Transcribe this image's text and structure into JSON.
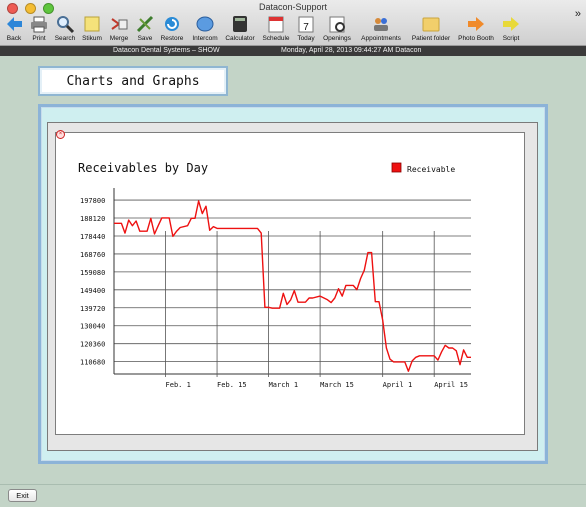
{
  "window": {
    "title": "Datacon-Support"
  },
  "toolbar": [
    {
      "label": "Back",
      "icon": "back-arrow-icon",
      "x": 0
    },
    {
      "label": "Print",
      "icon": "printer-icon",
      "x": 1
    },
    {
      "label": "Search",
      "icon": "search-icon",
      "x": 2
    },
    {
      "label": "Stikum",
      "icon": "sticky-note-icon",
      "x": 3
    },
    {
      "label": "Merge",
      "icon": "merge-icon",
      "x": 4
    },
    {
      "label": "Save",
      "icon": "save-icon",
      "x": 5
    },
    {
      "label": "Restore",
      "icon": "restore-icon",
      "x": 6
    },
    {
      "label": "Intercom",
      "icon": "intercom-icon",
      "x": 7
    },
    {
      "label": "Calculator",
      "icon": "calculator-icon",
      "x": 8
    },
    {
      "label": "Schedule",
      "icon": "schedule-icon",
      "x": 9
    },
    {
      "label": "Today",
      "icon": "calendar-today-icon",
      "x": 10
    },
    {
      "label": "Openings",
      "icon": "openings-icon",
      "x": 11
    },
    {
      "label": "Appointments",
      "icon": "appointments-icon",
      "x": 12
    },
    {
      "label": "Patient folder",
      "icon": "folder-icon",
      "x": 13
    },
    {
      "label": "Photo Booth",
      "icon": "photo-booth-icon",
      "x": 14
    },
    {
      "label": "Script",
      "icon": "script-icon",
      "x": 15
    }
  ],
  "infobar": {
    "left": "Datacon Dental Systems – SHOW",
    "right": "Monday, April 28, 2013  09:44:27 AM  Datacon"
  },
  "page_title": "Charts and Graphs",
  "exit_label": "Exit",
  "colors": {
    "series": "#ee1111",
    "panel_border": "#8cb3d8"
  },
  "chart_data": {
    "type": "line",
    "title": "Receivables by Day",
    "legend": [
      "Receivable"
    ],
    "legend_position": "top-right",
    "ylim": [
      104000,
      200000
    ],
    "yticks": [
      110680,
      120360,
      130040,
      139720,
      149400,
      159080,
      168760,
      178440,
      188120,
      197800
    ],
    "xticks": [
      "Feb. 1",
      "Feb. 15",
      "March 1",
      "March 15",
      "April 1",
      "April 15"
    ],
    "xtick_dates": [
      "2013-02-01",
      "2013-02-15",
      "2013-03-01",
      "2013-03-15",
      "2013-04-01",
      "2013-04-15"
    ],
    "grid": "horizontal",
    "series": [
      {
        "name": "Receivable",
        "points": [
          [
            "2013-01-18",
            185300
          ],
          [
            "2013-01-20",
            185300
          ],
          [
            "2013-01-21",
            180000
          ],
          [
            "2013-01-22",
            187000
          ],
          [
            "2013-01-23",
            184000
          ],
          [
            "2013-01-24",
            186500
          ],
          [
            "2013-01-25",
            181000
          ],
          [
            "2013-01-27",
            181000
          ],
          [
            "2013-01-28",
            188000
          ],
          [
            "2013-01-29",
            179500
          ],
          [
            "2013-01-30",
            184000
          ],
          [
            "2013-01-31",
            188200
          ],
          [
            "2013-02-02",
            188200
          ],
          [
            "2013-02-03",
            178200
          ],
          [
            "2013-02-04",
            181000
          ],
          [
            "2013-02-05",
            183000
          ],
          [
            "2013-02-07",
            184000
          ],
          [
            "2013-02-08",
            188000
          ],
          [
            "2013-02-09",
            188000
          ],
          [
            "2013-02-10",
            197300
          ],
          [
            "2013-02-11",
            190500
          ],
          [
            "2013-02-12",
            194500
          ],
          [
            "2013-02-13",
            181500
          ],
          [
            "2013-02-14",
            183500
          ],
          [
            "2013-02-15",
            182500
          ],
          [
            "2013-02-20",
            182500
          ],
          [
            "2013-02-25",
            182500
          ],
          [
            "2013-02-26",
            182500
          ],
          [
            "2013-02-27",
            180000
          ],
          [
            "2013-02-28",
            140000
          ],
          [
            "2013-03-01",
            140000
          ],
          [
            "2013-03-02",
            139500
          ],
          [
            "2013-03-03",
            139500
          ],
          [
            "2013-03-04",
            139500
          ],
          [
            "2013-03-05",
            147500
          ],
          [
            "2013-03-06",
            141500
          ],
          [
            "2013-03-07",
            144000
          ],
          [
            "2013-03-08",
            149000
          ],
          [
            "2013-03-09",
            142700
          ],
          [
            "2013-03-10",
            142700
          ],
          [
            "2013-03-11",
            142700
          ],
          [
            "2013-03-12",
            145000
          ],
          [
            "2013-03-13",
            145000
          ],
          [
            "2013-03-15",
            146000
          ],
          [
            "2013-03-17",
            144000
          ],
          [
            "2013-03-18",
            142500
          ],
          [
            "2013-03-19",
            145000
          ],
          [
            "2013-03-20",
            150000
          ],
          [
            "2013-03-21",
            146000
          ],
          [
            "2013-03-22",
            151800
          ],
          [
            "2013-03-23",
            151800
          ],
          [
            "2013-03-24",
            151800
          ],
          [
            "2013-03-25",
            149500
          ],
          [
            "2013-03-26",
            155500
          ],
          [
            "2013-03-27",
            160000
          ],
          [
            "2013-03-28",
            169500
          ],
          [
            "2013-03-29",
            169500
          ],
          [
            "2013-03-30",
            143000
          ],
          [
            "2013-03-31",
            143000
          ],
          [
            "2013-04-01",
            133000
          ],
          [
            "2013-04-02",
            118000
          ],
          [
            "2013-04-03",
            112000
          ],
          [
            "2013-04-04",
            110500
          ],
          [
            "2013-04-05",
            110500
          ],
          [
            "2013-04-06",
            110500
          ],
          [
            "2013-04-07",
            110500
          ],
          [
            "2013-04-08",
            105500
          ],
          [
            "2013-04-09",
            111000
          ],
          [
            "2013-04-10",
            113000
          ],
          [
            "2013-04-11",
            113800
          ],
          [
            "2013-04-12",
            113800
          ],
          [
            "2013-04-13",
            113800
          ],
          [
            "2013-04-14",
            113800
          ],
          [
            "2013-04-15",
            113800
          ],
          [
            "2013-04-16",
            111500
          ],
          [
            "2013-04-17",
            116000
          ],
          [
            "2013-04-18",
            119500
          ],
          [
            "2013-04-19",
            118000
          ],
          [
            "2013-04-20",
            118000
          ],
          [
            "2013-04-21",
            116500
          ],
          [
            "2013-04-22",
            109000
          ],
          [
            "2013-04-23",
            117000
          ],
          [
            "2013-04-24",
            113000
          ],
          [
            "2013-04-25",
            113000
          ]
        ]
      }
    ]
  }
}
